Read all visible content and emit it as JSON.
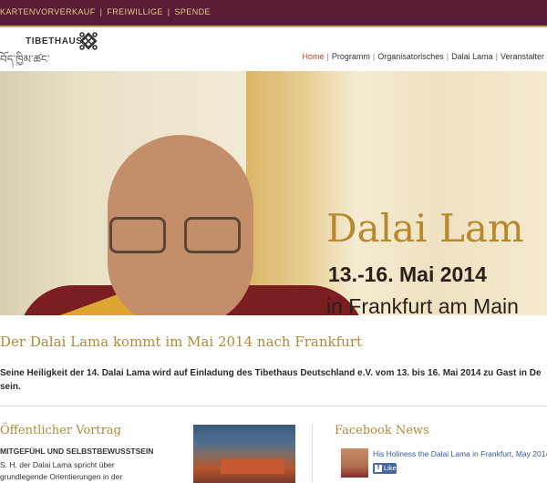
{
  "topbar": {
    "links": [
      "KARTENVORVERKAUF",
      "FREIWILLIGE",
      "SPENDE"
    ],
    "background": "#5a1b34",
    "link_color": "#e8c986"
  },
  "logo": {
    "brand": "TIBETHAUS",
    "script": "བོད་ཁྱིམ་ཚང་"
  },
  "nav": {
    "items": [
      "Home",
      "Programm",
      "Organisatorisches",
      "Dalai Lama",
      "Veranstalter"
    ],
    "active": "Home"
  },
  "hero": {
    "title": "Dalai Lam",
    "date": "13.-16. Mai 2014",
    "city": "in Frankfurt am Main"
  },
  "content": {
    "headline": "Der Dalai Lama kommt im Mai 2014 nach Frankfurt",
    "intro_line1": "Seine Heiligkeit der 14. Dalai Lama wird auf Einladung des Tibethaus Deutschland e.V. vom 13. bis 16. Mai 2014 zu Gast in De",
    "intro_line2": "sein."
  },
  "lecture": {
    "title": "Öffentlicher Vortrag",
    "subtitle": "MITGEFÜHL UND SELBSTBEWUSSTSEIN",
    "text_line1": "S. H. der Dalai Lama spricht über",
    "text_line2": "grundlegende Orientierungen in der"
  },
  "facebook": {
    "title": "Facebook News",
    "post_link": "His Holiness the Dalai Lama in Frankfurt, May 2014",
    "like_label": "Like"
  },
  "colors": {
    "accent_gold": "#b08a3a",
    "nav_active": "#b5452b",
    "facebook_blue": "#3b5998"
  }
}
